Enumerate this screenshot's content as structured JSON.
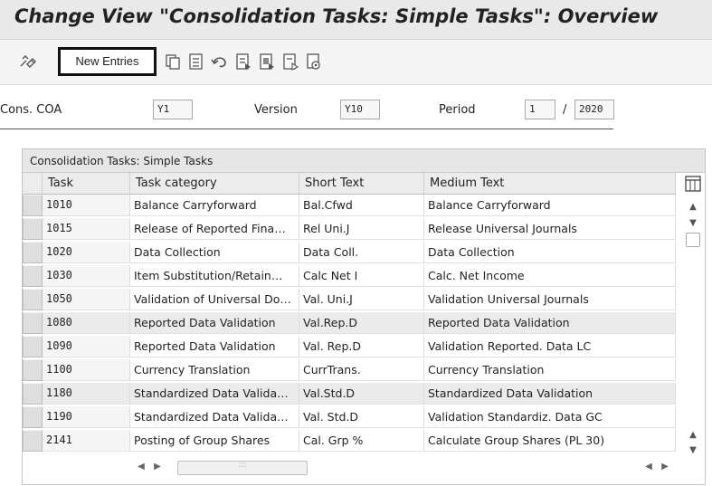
{
  "title": "Change View \"Consolidation Tasks: Simple Tasks\": Overview",
  "toolbar": {
    "new_entries_label": "New Entries",
    "icons": [
      "display-change-icon",
      "copy-icon",
      "delete-icon",
      "undo-icon",
      "select-all-icon",
      "select-block-icon",
      "deselect-all-icon",
      "config-icon"
    ]
  },
  "selection": {
    "cons_coa_label": "Cons. COA",
    "cons_coa_value": "Y1",
    "version_label": "Version",
    "version_value": "Y10",
    "period_label": "Period",
    "period_value": "1",
    "slash": "/",
    "year_value": "2020"
  },
  "table": {
    "caption": "Consolidation Tasks: Simple Tasks",
    "columns": [
      "Task",
      "Task category",
      "Short Text",
      "Medium Text"
    ],
    "rows": [
      {
        "task": "1010",
        "category": "Balance Carryforward",
        "short": "Bal.Cfwd",
        "medium": "Balance Carryforward",
        "highlight": false
      },
      {
        "task": "1015",
        "category": "Release of Reported Fina…",
        "short": "Rel Uni.J",
        "medium": "Release Universal Journals",
        "highlight": false
      },
      {
        "task": "1020",
        "category": "Data Collection",
        "short": "Data Coll.",
        "medium": "Data Collection",
        "highlight": false
      },
      {
        "task": "1030",
        "category": "Item Substitution/Retain…",
        "short": "Calc Net I",
        "medium": "Calc. Net Income",
        "highlight": false
      },
      {
        "task": "1050",
        "category": "Validation of Universal Do…",
        "short": "Val. Uni.J",
        "medium": "Validation Universal Journals",
        "highlight": false
      },
      {
        "task": "1080",
        "category": "Reported Data Validation",
        "short": "Val.Rep.D",
        "medium": "Reported Data Validation",
        "highlight": true
      },
      {
        "task": "1090",
        "category": "Reported Data Validation",
        "short": "Val. Rep.D",
        "medium": "Validation Reported. Data LC",
        "highlight": false
      },
      {
        "task": "1100",
        "category": "Currency Translation",
        "short": "CurrTrans.",
        "medium": "Currency Translation",
        "highlight": false
      },
      {
        "task": "1180",
        "category": "Standardized Data Valida…",
        "short": "Val.Std.D",
        "medium": "Standardized Data Validation",
        "highlight": true
      },
      {
        "task": "1190",
        "category": "Standardized Data Valida…",
        "short": "Val. Std.D",
        "medium": "Validation Standardiz. Data GC",
        "highlight": false
      },
      {
        "task": "2141",
        "category": "Posting of Group Shares",
        "short": "Cal. Grp %",
        "medium": "Calculate Group Shares (PL 30)",
        "highlight": false
      }
    ]
  },
  "colors": {
    "title_bar": "#e9e9e9",
    "toolbar": "#f4f4f4",
    "row_highlight": "#ebebeb",
    "header": "#ececec"
  }
}
